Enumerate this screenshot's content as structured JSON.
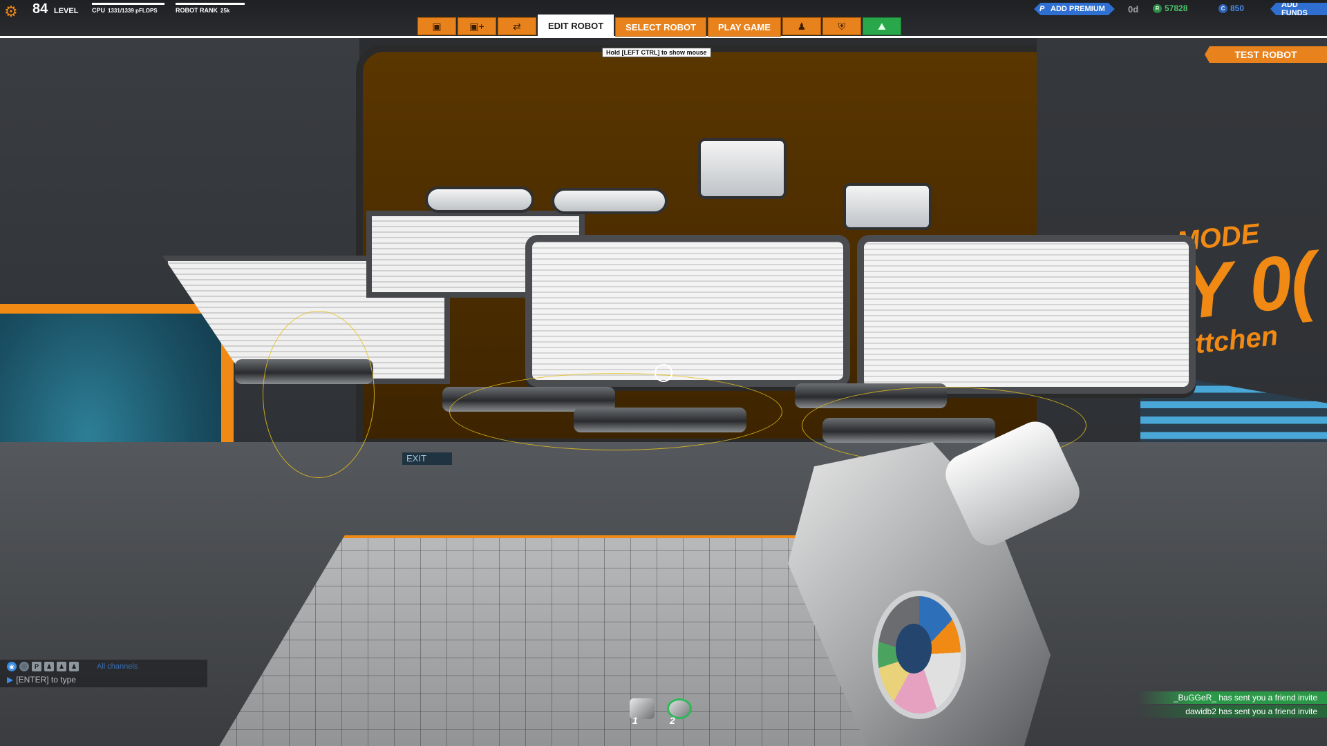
{
  "hud": {
    "level": "84",
    "level_label": "LEVEL",
    "cpu_label": "CPU",
    "cpu_value": "1331/1339 pFLOPS",
    "rank_label": "ROBOT RANK",
    "rank_value": "25k"
  },
  "nav": {
    "icon_buttons_left": [
      "cube-icon",
      "cube-add-icon",
      "connect-icon"
    ],
    "tabs": [
      {
        "label": "EDIT ROBOT",
        "active": true
      },
      {
        "label": "SELECT ROBOT",
        "active": false
      },
      {
        "label": "PLAY GAME",
        "active": false
      }
    ],
    "icon_buttons_right": [
      "players-icon",
      "shield-icon",
      "shop-icon"
    ],
    "tooltip": "Hold [LEFT CTRL] to show mouse"
  },
  "currency": {
    "premium_label": "ADD PREMIUM",
    "premium_days": "0d",
    "robits": "57828",
    "cosmo": "850",
    "funds_label": "ADD FUNDS"
  },
  "actions": {
    "test_robot": "TEST ROBOT"
  },
  "scene": {
    "sign_line1": "MODE",
    "sign_line2": "Y 0(",
    "sign_line3": "ittchen",
    "exit_sign": "EXIT"
  },
  "chat": {
    "channel": "All channels",
    "input_hint": "[ENTER] to type"
  },
  "hotbar": {
    "slots": [
      {
        "number": "1",
        "selected": false
      },
      {
        "number": "2",
        "selected": true
      }
    ]
  },
  "notifications": [
    "_BuGGeR_ has sent you a friend invite",
    "dawidb2 has sent you a friend invite"
  ],
  "colors": {
    "accent": "#e8821c",
    "premium": "#2e6fd1",
    "robits": "#4cc46b",
    "notification": "#28a84a"
  }
}
